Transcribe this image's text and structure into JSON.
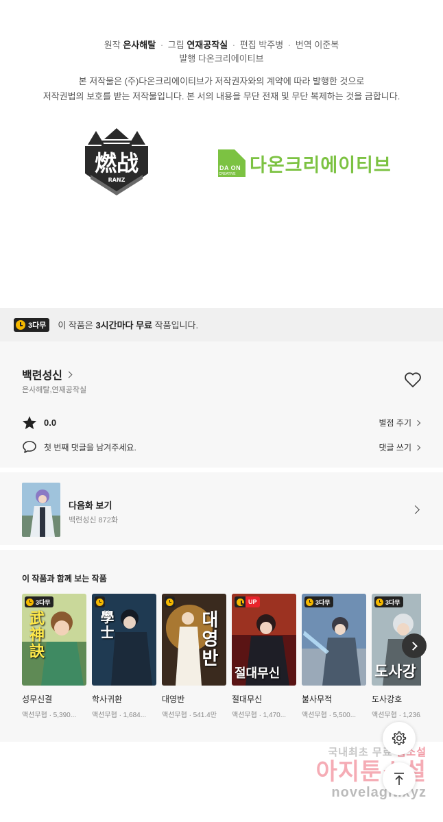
{
  "credits": {
    "original_label": "원작",
    "original_value": "은사해탈",
    "art_label": "그림",
    "art_value": "연재공작실",
    "edit_label": "편집",
    "edit_value": "박주병",
    "translate_label": "번역",
    "translate_value": "이준복",
    "publisher_label": "발행",
    "publisher_value": "다온크리에이티브",
    "separator": "·"
  },
  "notice": {
    "line1": "본 저작물은 (주)다온크리에이티브가 저작권자와의 계약에 따라 발행한 것으로",
    "line2": "저작권법의 보호를 받는 저작물입니다. 본 서의 내용을 무단 전재 및 무단 복제하는 것을 금합니다."
  },
  "logos": {
    "left_logo_text": "燃战",
    "left_logo_sub": "RANZ",
    "right_logo_box": "DA ON",
    "right_logo_box_sub": "CREATIVE",
    "right_logo_name": "다온크리에이티브",
    "right_logo_color": "#7cc242"
  },
  "free_banner": {
    "badge": "3다무",
    "text_prefix": "이 작품은",
    "text_bold": "3시간마다 무료",
    "text_suffix": "작품입니다."
  },
  "series": {
    "title": "백련성신",
    "authors": "은사해탈,연재공작실",
    "rating": "0.0",
    "rate_link": "별점 주기",
    "comment_prompt": "첫 번째 댓글을 남겨주세요.",
    "comment_link": "댓글 쓰기"
  },
  "next_episode": {
    "title": "다음화 보기",
    "subtitle": "백련성신 872화"
  },
  "recommendations": {
    "heading": "이 작품과 함께 보는 작품",
    "items": [
      {
        "name": "성무신결",
        "meta": "액션무협 · 5,390...",
        "badge": "3다무",
        "cover_text": "武神訣"
      },
      {
        "name": "학사귀환",
        "meta": "액션무협 · 1,684...",
        "badge": "",
        "cover_text": "學士"
      },
      {
        "name": "대영반",
        "meta": "액션무협 · 541.4만",
        "badge": "",
        "cover_text": "대영반"
      },
      {
        "name": "절대무신",
        "meta": "액션무협 · 1,470...",
        "badge": "UP",
        "cover_text": "절대무신"
      },
      {
        "name": "불사무적",
        "meta": "액션무협 · 5,500...",
        "badge": "3다무",
        "cover_text": ""
      },
      {
        "name": "도사강호",
        "meta": "액션무협 · 1,236...",
        "badge": "3다무",
        "cover_text": "도사강"
      }
    ]
  },
  "watermark": {
    "line1_a": "국내최초 무료",
    "line1_b": "웹소설",
    "line2": "아지툰소설",
    "line3": "novelagit.xyz"
  }
}
